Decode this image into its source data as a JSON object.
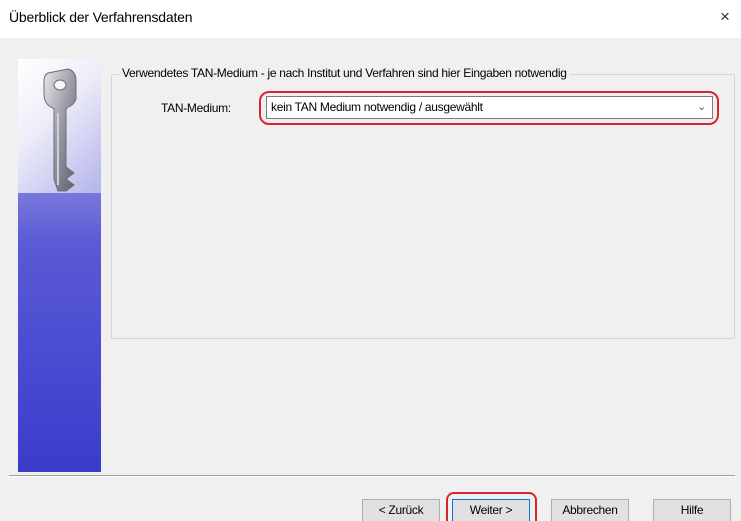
{
  "window": {
    "title": "Überblick der Verfahrensdaten",
    "close_label": "×"
  },
  "banner": {
    "icon": "key-icon"
  },
  "group": {
    "legend": "Verwendetes TAN-Medium - je nach Institut und Verfahren sind hier Eingaben notwendig"
  },
  "tan_medium": {
    "label": "TAN-Medium:",
    "selected": "kein TAN Medium notwendig / ausgewählt",
    "arrow": "⌄"
  },
  "buttons": {
    "back": "< Zurück",
    "next": "Weiter >",
    "cancel": "Abbrechen",
    "help": "Hilfe"
  },
  "highlight_color": "#d9252f"
}
